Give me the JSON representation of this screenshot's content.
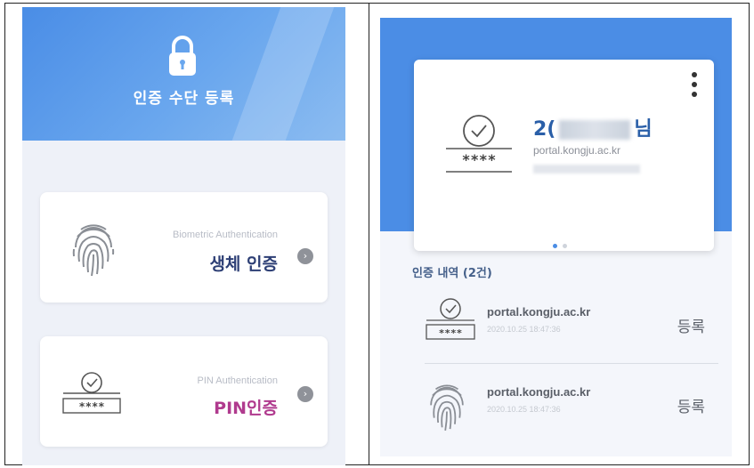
{
  "left_panel": {
    "title": "인증 수단 등록",
    "cards": [
      {
        "sub": "Biometric Authentication",
        "label": "생체 인증",
        "label_color": "#2d3f75"
      },
      {
        "sub": "PIN Authentication",
        "label": "PIN인증",
        "label_color": "#b03a8e"
      }
    ]
  },
  "right_panel": {
    "account": {
      "name_prefix": "2(",
      "name_suffix": "님",
      "host": "portal.kongju.ac.kr",
      "page_count": 2,
      "active_page": 1
    },
    "history_title": "인증 내역 (2건)",
    "history": [
      {
        "host": "portal.kongju.ac.kr",
        "time": "2020.10.25 18:47:36",
        "status": "등록",
        "icon": "pin-icon"
      },
      {
        "host": "portal.kongju.ac.kr",
        "time": "2020.10.25 18:47:36",
        "status": "등록",
        "icon": "fingerprint-icon"
      }
    ]
  },
  "colors": {
    "header_blue": "#4b8de5",
    "pin_accent": "#b03a8e",
    "bio_accent": "#2d3f75"
  }
}
